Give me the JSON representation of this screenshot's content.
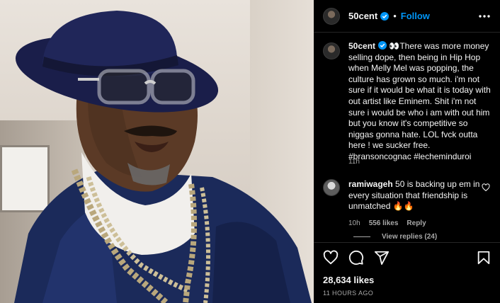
{
  "post": {
    "username": "50cent",
    "follow_label": "Follow",
    "dot": "•",
    "caption_username": "50cent",
    "caption_text": "👀There was more money selling dope, then being in Hip Hop when Melly Mel was popping, the culture has grown so much. i'm not sure if it would be what it is today with out artist like Eminem. Shit i'm not sure i would be who i am with out him but you know it's competitive so niggas gonna hate. LOL fvck outta here ! we sucker free. #bransoncognac #lecheminduroi",
    "caption_time": "11h",
    "likes": "28,634 likes",
    "age": "11 HOURS AGO"
  },
  "comment": {
    "username": "ramiwageh",
    "text": "50 is backing up em in every situation that friendship is unmatched 🔥🔥",
    "time": "10h",
    "likes": "556 likes",
    "reply_label": "Reply"
  },
  "view_replies": "View replies (24)",
  "colors": {
    "accent": "#0095f6",
    "verified": "#0095f6",
    "muted": "#a8a8a8"
  },
  "icons": [
    "more-icon",
    "verified-badge-icon",
    "heart-icon",
    "comment-icon",
    "share-icon",
    "bookmark-icon"
  ]
}
